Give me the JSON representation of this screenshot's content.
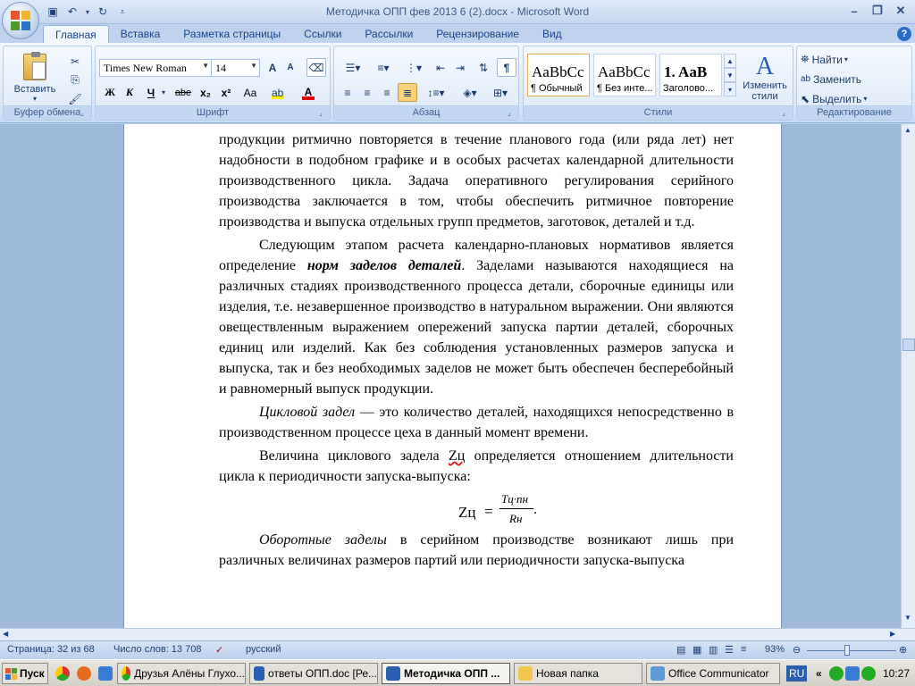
{
  "window": {
    "title": "Методичка ОПП фев 2013 6 (2).docx - Microsoft Word"
  },
  "tabs": [
    "Главная",
    "Вставка",
    "Разметка страницы",
    "Ссылки",
    "Рассылки",
    "Рецензирование",
    "Вид"
  ],
  "ribbon": {
    "clipboard": {
      "label": "Буфер обмена",
      "paste": "Вставить"
    },
    "font": {
      "label": "Шрифт",
      "font_name": "Times New Roman",
      "font_size": "14",
      "bold": "Ж",
      "italic": "К",
      "underline": "Ч",
      "strike": "abe",
      "subscript": "x₂",
      "superscript": "x²",
      "case": "Aa",
      "grow": "A",
      "shrink": "A"
    },
    "paragraph": {
      "label": "Абзац",
      "show_marks": "¶"
    },
    "styles": {
      "label": "Стили",
      "change_styles": "Изменить стили",
      "items": [
        {
          "sample": "AaBbCc",
          "name": "¶ Обычный"
        },
        {
          "sample": "AaBbCc",
          "name": "¶ Без инте..."
        },
        {
          "sample": "1. AaB",
          "name": "Заголово..."
        }
      ]
    },
    "editing": {
      "label": "Редактирование",
      "find": "Найти",
      "replace": "Заменить",
      "select": "Выделить"
    }
  },
  "document": {
    "para1": "продукции ритмично повторяется в течение планового года (или ряда лет) нет надобности в подобном графике и в особых расчетах календарной длительности производственного цикла. Задача оперативного регулирования серийного производства заключается в том, чтобы обеспечить ритмичное повторение производства и выпуска отдельных групп предметов, заготовок, деталей и т.д.",
    "para2_start": "Следующим этапом расчета календарно-плановых нормативов является определение ",
    "para2_term": "норм заделов деталей",
    "para2_end": ". Заделами называются находящиеся на различных стадиях производственного процесса детали, сборочные единицы или изделия, т.е. незавершенное производство в натуральном выражении. Они являются овеществленным выражением опережений запуска партии деталей, сборочных единиц или изделий. Как без соблюдения установленных размеров запуска и выпуска, так и без необходимых заделов не может быть обеспечен бесперебойный и равномерный выпуск продукции.",
    "para3_term": "Цикловой задел",
    "para3_rest": " — это количество деталей, находящихся непосредственно в производственном процессе цеха в данный момент времени.",
    "para4_start": "Величина циклового задела ",
    "para4_symbol": "Zц",
    "para4_end": " определяется отношением длительности цикла к периодичности запуска-выпуска:",
    "formula_lhs": "Zц",
    "formula_num": "Tц·nн",
    "formula_den": "Rн",
    "para5_term": "Оборотные заделы",
    "para5_rest": " в серийном производстве возникают лишь при различных величинах размеров партий или периодичности запуска-выпуска"
  },
  "status": {
    "page": "Страница: 32 из 68",
    "words": "Число слов: 13 708",
    "language": "русский",
    "zoom": "93%"
  },
  "taskbar": {
    "start": "Пуск",
    "tasks": [
      "Друзья Алёны Глухо...",
      "ответы ОПП.doc [Ре...",
      "Методичка ОПП ...",
      "Новая папка",
      "Office Communicator"
    ],
    "lang": "RU",
    "clock": "10:27"
  },
  "colors": {
    "ribbon_bg": "#dbe8f8",
    "accent": "#15428b",
    "page_bg": "#ffffff",
    "workspace": "#9fb9dc"
  }
}
